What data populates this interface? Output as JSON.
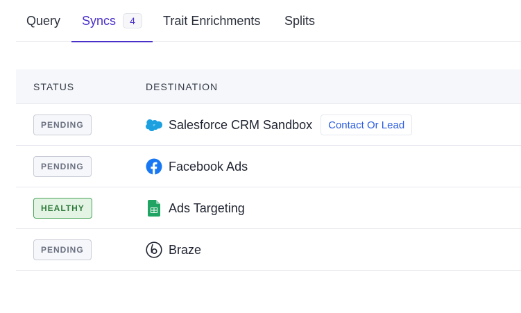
{
  "tabs": [
    {
      "label": "Query"
    },
    {
      "label": "Syncs",
      "count": "4"
    },
    {
      "label": "Trait Enrichments"
    },
    {
      "label": "Splits"
    }
  ],
  "table": {
    "headers": {
      "status": "STATUS",
      "destination": "DESTINATION"
    },
    "rows": [
      {
        "status": "PENDING",
        "destination": "Salesforce CRM Sandbox",
        "icon": "salesforce-icon",
        "tag": "Contact Or Lead"
      },
      {
        "status": "PENDING",
        "destination": "Facebook Ads",
        "icon": "facebook-icon"
      },
      {
        "status": "HEALTHY",
        "destination": "Ads Targeting",
        "icon": "google-sheets-icon"
      },
      {
        "status": "PENDING",
        "destination": "Braze",
        "icon": "braze-icon"
      }
    ]
  },
  "colors": {
    "accent": "#4b2fc9",
    "healthy": "#2f7a3b",
    "link": "#2a5ce0"
  }
}
